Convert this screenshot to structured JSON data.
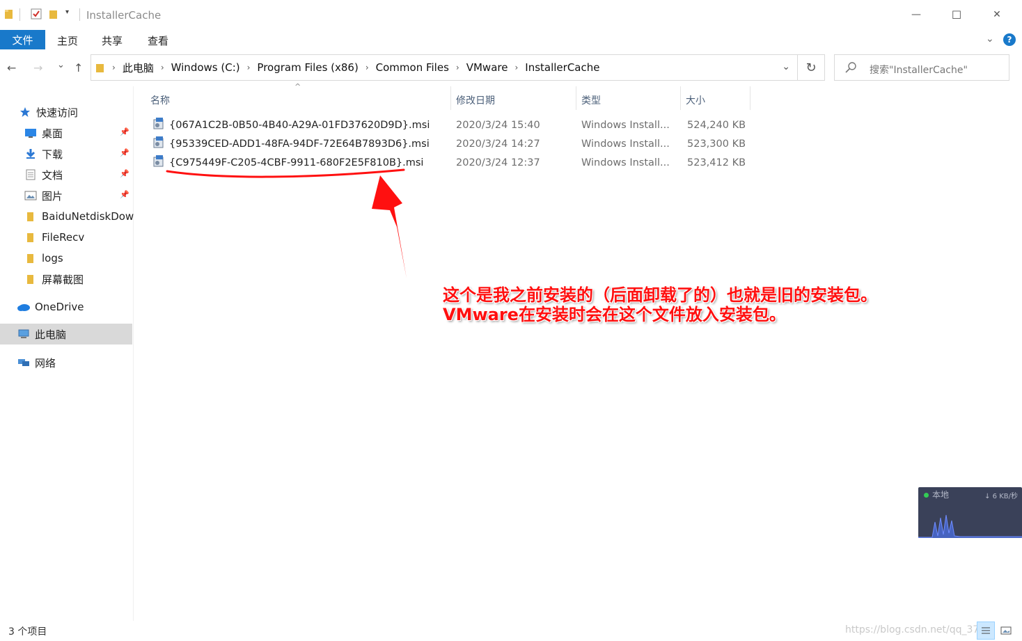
{
  "window": {
    "title": "InstallerCache",
    "minimize": "—",
    "maximize": "☐",
    "close": "✕"
  },
  "ribbon": {
    "file": "文件",
    "tabs": [
      "主页",
      "共享",
      "查看"
    ],
    "help": "?"
  },
  "nav": {
    "back": "←",
    "forward": "→",
    "recent": "⌄",
    "up": "↑",
    "breadcrumb": [
      "此电脑",
      "Windows (C:)",
      "Program Files (x86)",
      "Common Files",
      "VMware",
      "InstallerCache"
    ],
    "refresh": "↻",
    "search_placeholder": "搜索\"InstallerCache\""
  },
  "sidebar": {
    "quick_access": "快速访问",
    "pinned": [
      "桌面",
      "下载",
      "文档",
      "图片"
    ],
    "folders": [
      "BaiduNetdiskDow",
      "FileRecv",
      "logs",
      "屏幕截图"
    ],
    "onedrive": "OneDrive",
    "this_pc": "此电脑",
    "network": "网络"
  },
  "columns": {
    "name": "名称",
    "date": "修改日期",
    "type": "类型",
    "size": "大小"
  },
  "files": [
    {
      "name": "{067A1C2B-0B50-4B40-A29A-01FD37620D9D}.msi",
      "date": "2020/3/24 15:40",
      "type": "Windows Install...",
      "size": "524,240 KB"
    },
    {
      "name": "{95339CED-ADD1-48FA-94DF-72E64B7893D6}.msi",
      "date": "2020/3/24 14:27",
      "type": "Windows Install...",
      "size": "523,300 KB"
    },
    {
      "name": "{C975449F-C205-4CBF-9911-680F2E5F810B}.msi",
      "date": "2020/3/24 12:37",
      "type": "Windows Install...",
      "size": "523,412 KB"
    }
  ],
  "annotation": {
    "line1": "这个是我之前安装的（后面卸载了的）也就是旧的安装包。",
    "line2": "VMware在安装时会在这个文件放入安装包。"
  },
  "network_widget": {
    "label": "本地",
    "speed": "↓ 6 KB/秒"
  },
  "status": {
    "item_count": "3 个项目",
    "watermark": "https://blog.csdn.net/qq_37"
  },
  "colors": {
    "accent": "#1979ca",
    "annotation": "#ff1010",
    "header_text": "#4c607a"
  }
}
